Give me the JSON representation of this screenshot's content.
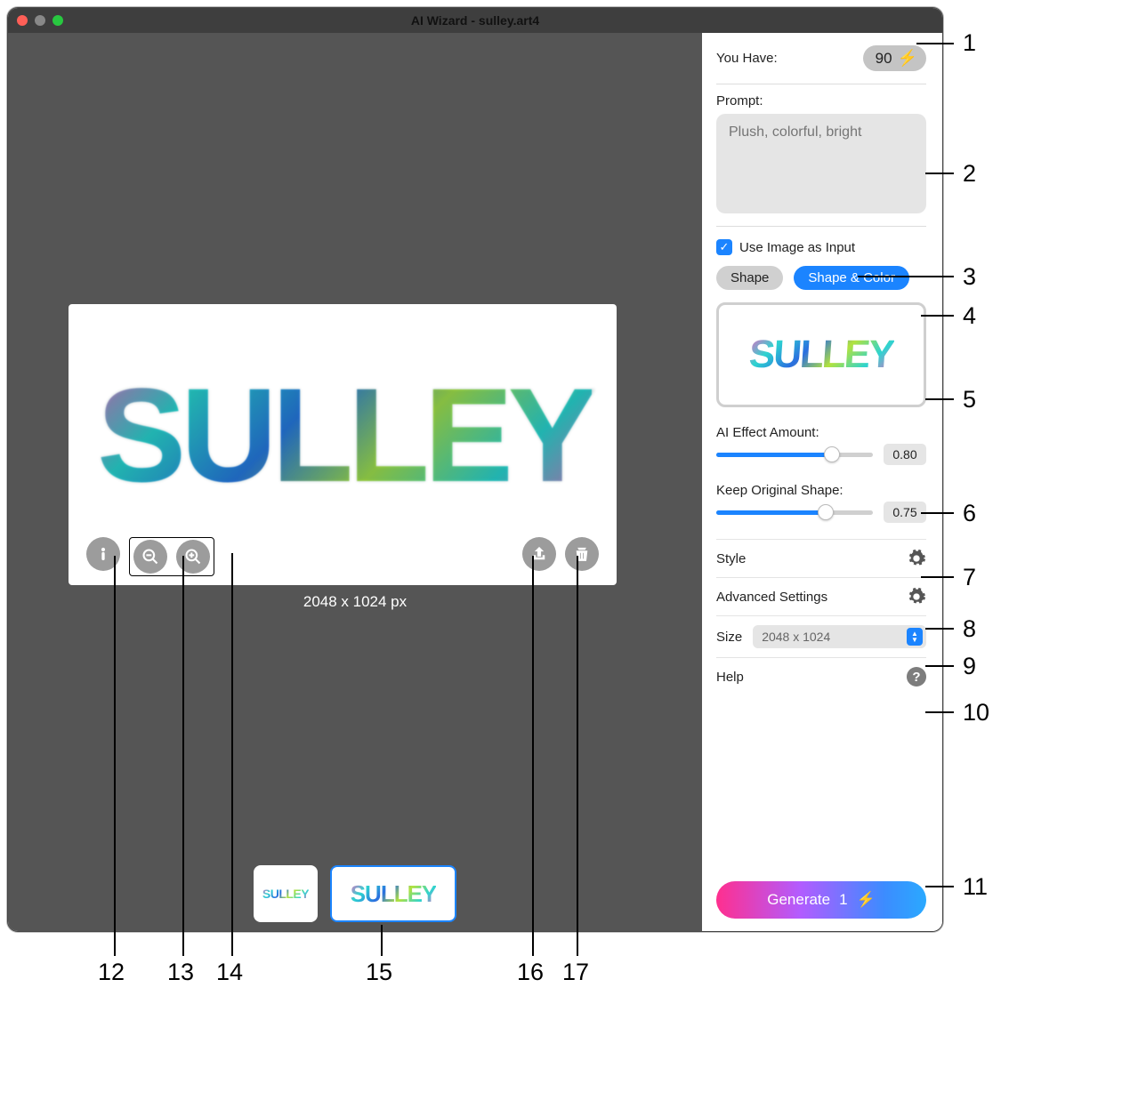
{
  "window": {
    "title": "AI Wizard - sulley.art4"
  },
  "canvas": {
    "preview_text": "SULLEY",
    "dimensions": "2048 x 1024 px",
    "thumb_small_text": "SULLEY",
    "thumb_big_text": "SULLEY"
  },
  "side": {
    "you_have_label": "You Have:",
    "credits": "90",
    "prompt_label": "Prompt:",
    "prompt_placeholder": "Plush, colorful, bright",
    "use_image_label": "Use Image as Input",
    "use_image_checked": true,
    "seg_shape": "Shape",
    "seg_shape_color": "Shape & Color",
    "input_thumb_text": "SULLEY",
    "effect_label": "AI Effect Amount:",
    "effect_value": "0.80",
    "effect_pct": 80,
    "keep_label": "Keep Original Shape:",
    "keep_value": "0.75",
    "keep_pct": 75,
    "style_label": "Style",
    "advanced_label": "Advanced Settings",
    "size_label": "Size",
    "size_value": "2048 x 1024",
    "help_label": "Help",
    "generate_label": "Generate",
    "generate_cost": "1"
  },
  "callouts": {
    "n1": "1",
    "n2": "2",
    "n3": "3",
    "n4": "4",
    "n5": "5",
    "n6": "6",
    "n7": "7",
    "n8": "8",
    "n9": "9",
    "n10": "10",
    "n11": "11",
    "n12": "12",
    "n13": "13",
    "n14": "14",
    "n15": "15",
    "n16": "16",
    "n17": "17"
  }
}
